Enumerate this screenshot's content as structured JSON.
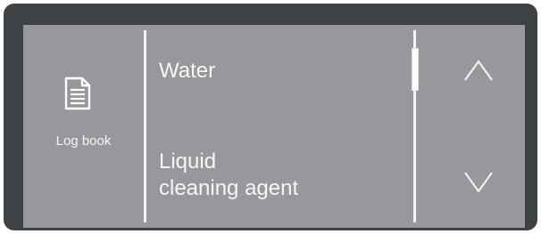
{
  "sidebar": {
    "icon": "document-icon",
    "label": "Log book"
  },
  "list": {
    "items": [
      {
        "label": "Water"
      },
      {
        "label": "Liquid\ncleaning agent"
      }
    ]
  },
  "scroll": {
    "up_icon": "chevron-up-icon",
    "down_icon": "chevron-down-icon"
  },
  "colors": {
    "bezel": "#3f4245",
    "screen": "#96989b",
    "foreground": "#f6f6f6"
  }
}
